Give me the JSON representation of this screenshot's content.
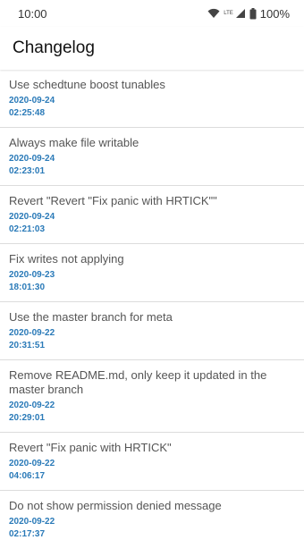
{
  "status_bar": {
    "time": "10:00",
    "network": "LTE",
    "battery": "100%"
  },
  "app_bar": {
    "title": "Changelog"
  },
  "commits": [
    {
      "title": "Use schedtune boost tunables",
      "date": "2020-09-24",
      "time": "02:25:48"
    },
    {
      "title": "Always make file writable",
      "date": "2020-09-24",
      "time": "02:23:01"
    },
    {
      "title": "Revert \"Revert \"Fix panic with HRTICK\"\"",
      "date": "2020-09-24",
      "time": "02:21:03"
    },
    {
      "title": "Fix writes not applying",
      "date": "2020-09-23",
      "time": "18:01:30"
    },
    {
      "title": "Use the master branch for meta",
      "date": "2020-09-22",
      "time": "20:31:51"
    },
    {
      "title": "Remove README.md, only keep it updated in the master branch",
      "date": "2020-09-22",
      "time": "20:29:01"
    },
    {
      "title": "Revert \"Fix panic with HRTICK\"",
      "date": "2020-09-22",
      "time": "04:06:17"
    },
    {
      "title": "Do not show permission denied message",
      "date": "2020-09-22",
      "time": "02:17:37"
    }
  ]
}
